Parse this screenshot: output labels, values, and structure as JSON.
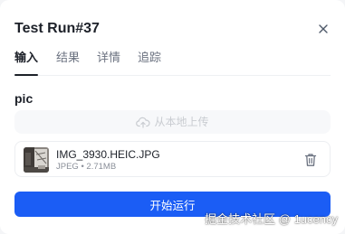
{
  "panel": {
    "title": "Test Run#37",
    "close_icon": "close-icon"
  },
  "tabs": [
    {
      "label": "输入",
      "active": true
    },
    {
      "label": "结果",
      "active": false
    },
    {
      "label": "详情",
      "active": false
    },
    {
      "label": "追踪",
      "active": false
    }
  ],
  "input": {
    "field_label": "pic",
    "upload_label": "从本地上传",
    "upload_icon": "cloud-upload-icon"
  },
  "file": {
    "name": "IMG_3930.HEIC.JPG",
    "type": "JPEG",
    "separator": "•",
    "size": "2.71MB",
    "delete_icon": "trash-icon"
  },
  "actions": {
    "run_label": "开始运行"
  },
  "watermark": {
    "text": "掘金技术社区 @ 1ucency"
  },
  "colors": {
    "primary": "#1b5df5",
    "text": "#1d2129",
    "muted": "#6b7280"
  }
}
